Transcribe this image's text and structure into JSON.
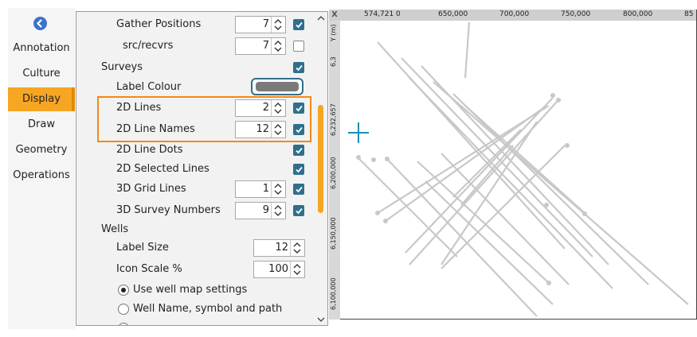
{
  "nav": {
    "items": [
      {
        "label": "Annotation"
      },
      {
        "label": "Culture"
      },
      {
        "label": "Display"
      },
      {
        "label": "Draw"
      },
      {
        "label": "Geometry"
      },
      {
        "label": "Operations"
      }
    ],
    "active": "Display"
  },
  "settings": {
    "gather_positions": {
      "label": "Gather Positions",
      "value": "7",
      "checked": true
    },
    "src_recvrs": {
      "label": "src/recvrs",
      "value": "7",
      "checked": false
    },
    "surveys": {
      "label": "Surveys",
      "checked": true
    },
    "label_colour": {
      "label": "Label Colour",
      "color": "#7a7a7a"
    },
    "lines_2d": {
      "label": "2D Lines",
      "value": "2",
      "checked": true
    },
    "line_names_2d": {
      "label": "2D Line Names",
      "value": "12",
      "checked": true
    },
    "line_dots_2d": {
      "label": "2D Line Dots",
      "checked": true
    },
    "selected_lines_2d": {
      "label": "2D Selected Lines",
      "checked": true
    },
    "grid_lines_3d": {
      "label": "3D Grid Lines",
      "value": "1",
      "checked": true
    },
    "survey_numbers_3d": {
      "label": "3D Survey Numbers",
      "value": "9",
      "checked": true
    },
    "wells": {
      "label": "Wells"
    },
    "label_size": {
      "label": "Label Size",
      "value": "12"
    },
    "icon_scale": {
      "label": "Icon Scale %",
      "value": "100"
    },
    "radio_map": {
      "label": "Use well map settings",
      "selected": true
    },
    "radio_name": {
      "label": "Well Name, symbol and path",
      "selected": false
    }
  },
  "map": {
    "x_axis_marker": "X",
    "y_axis_marker": "Y (m)",
    "cursor_x": "574,721",
    "x_ticks": [
      "0",
      "650,000",
      "700,000",
      "750,000",
      "800,000",
      "85"
    ],
    "cursor_y": "6,232,657",
    "y_ticks": [
      "6,3",
      "6,200,000",
      "6,150,000",
      "6,100,000"
    ],
    "line_color": "#c8c8c8",
    "cursor_color": "#1a8fb0"
  },
  "colors": {
    "accent": "#f6a623",
    "highlight": "#f28a16",
    "check": "#2f6f8e"
  }
}
